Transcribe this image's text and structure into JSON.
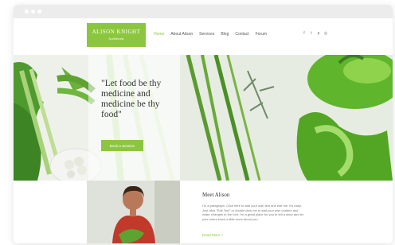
{
  "logo": {
    "name": "ALISON KNIGHT",
    "subtitle": "Nutritionist"
  },
  "nav": {
    "items": [
      {
        "label": "Home",
        "active": true
      },
      {
        "label": "About Alison"
      },
      {
        "label": "Services"
      },
      {
        "label": "Blog"
      },
      {
        "label": "Contact"
      },
      {
        "label": "Forum"
      }
    ]
  },
  "social": [
    {
      "icon": "facebook-icon",
      "glyph": "f"
    },
    {
      "icon": "twitter-icon",
      "glyph": "t"
    },
    {
      "icon": "pinterest-icon",
      "glyph": "p"
    },
    {
      "icon": "instagram-icon",
      "glyph": "◎"
    }
  ],
  "hero": {
    "quote": "\"Let food be thy medicine and medicine be thy food\"",
    "cta_label": "Book a Session"
  },
  "about": {
    "title": "Meet Alison",
    "body": "I'm a paragraph. Click here to add your own text and edit me. It's easy. Just click \"Edit Text\" or double click me to add your own content and make changes to the font. I'm a great place for you to tell a story and let your users know a little more about you.",
    "read_more": "Read More >"
  },
  "colors": {
    "accent": "#8cc63f",
    "text": "#333333",
    "muted": "#777777"
  }
}
